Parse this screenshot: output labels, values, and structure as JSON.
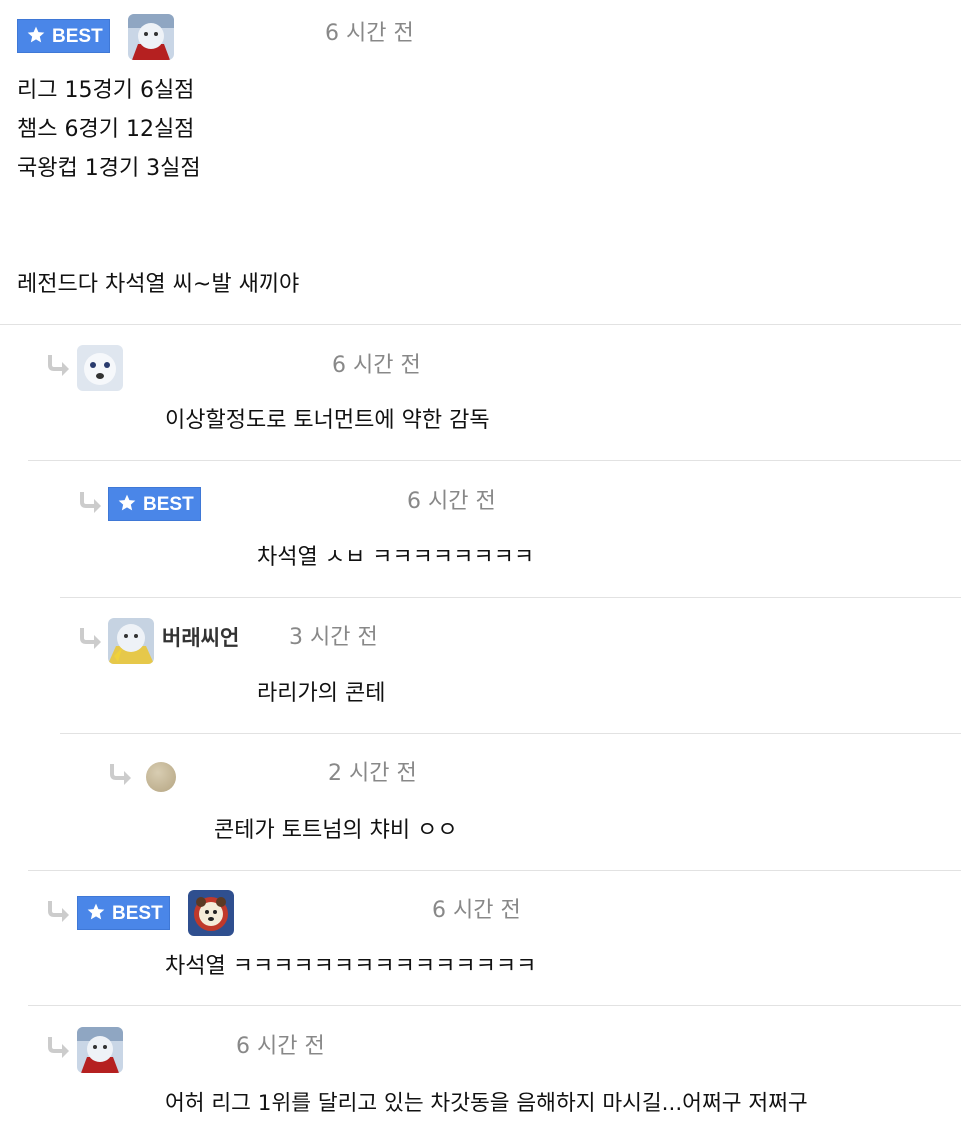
{
  "best_label": "BEST",
  "colors": {
    "best_bg": "#4a86e8",
    "time": "#888888",
    "separator": "#e2e2e2",
    "reply_arrow": "#cccccc"
  },
  "icons": {
    "best": "star-icon",
    "reply": "reply-arrow-icon"
  },
  "main_comment": {
    "time": "6 시간 전",
    "lines": [
      "리그 15경기 6실점",
      "챔스 6경기 12실점",
      "국왕컵 1경기 3실점",
      "레전드다 차석열 씨~발 새끼야"
    ]
  },
  "replies": [
    {
      "time": "6 시간 전",
      "text": "이상할정도로 토너먼트에 약한 감독"
    },
    {
      "best": true,
      "time": "6 시간 전",
      "text": "차석열 ㅅㅂ ㅋㅋㅋㅋㅋㅋㅋㅋ"
    },
    {
      "nickname": "버래씨언",
      "time": "3 시간 전",
      "text": "라리가의 콘테"
    },
    {
      "time": "2 시간 전",
      "text": "콘테가 토트넘의 챠비 ㅇㅇ"
    },
    {
      "best": true,
      "time": "6 시간 전",
      "text": "차석열 ㅋㅋㅋㅋㅋㅋㅋㅋㅋㅋㅋㅋㅋㅋㅋ"
    },
    {
      "time": "6 시간 전",
      "text": "어허 리그 1위를 달리고 있는 차갓동을 음해하지 마시길...어쩌구 저쩌구"
    }
  ]
}
